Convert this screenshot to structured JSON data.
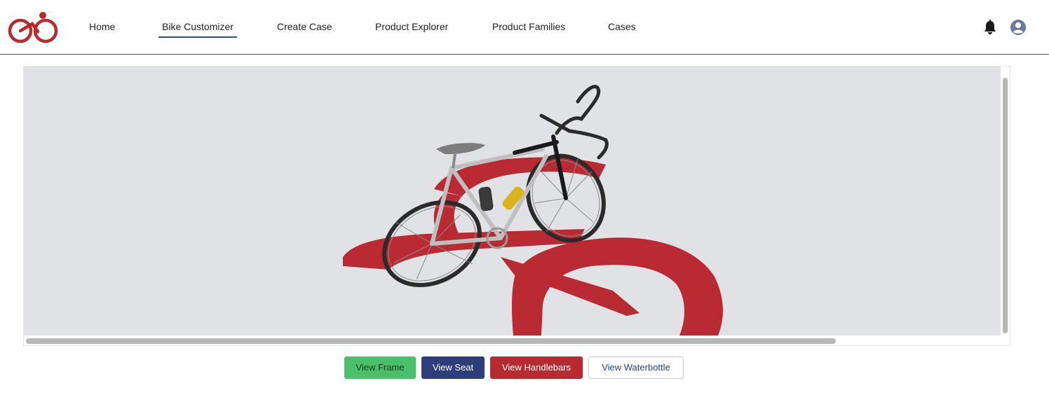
{
  "nav": {
    "items": [
      {
        "label": "Home"
      },
      {
        "label": "Bike Customizer",
        "active": true
      },
      {
        "label": "Create Case"
      },
      {
        "label": "Product Explorer"
      },
      {
        "label": "Product Families"
      },
      {
        "label": "Cases"
      }
    ],
    "icons": {
      "logo": "bike-logo-icon",
      "notifications": "bell-icon",
      "user": "user-avatar-icon"
    }
  },
  "viewer": {
    "icon": "3d-bike-model"
  },
  "buttons": {
    "frame": "View Frame",
    "seat": "View Seat",
    "handlebars": "View Handlebars",
    "waterbottle": "View Waterbottle"
  },
  "colors": {
    "brand_red": "#b62a30",
    "navy": "#2f3e7a",
    "green": "#4cbf6c",
    "scene_bg": "#e1e2e6"
  }
}
